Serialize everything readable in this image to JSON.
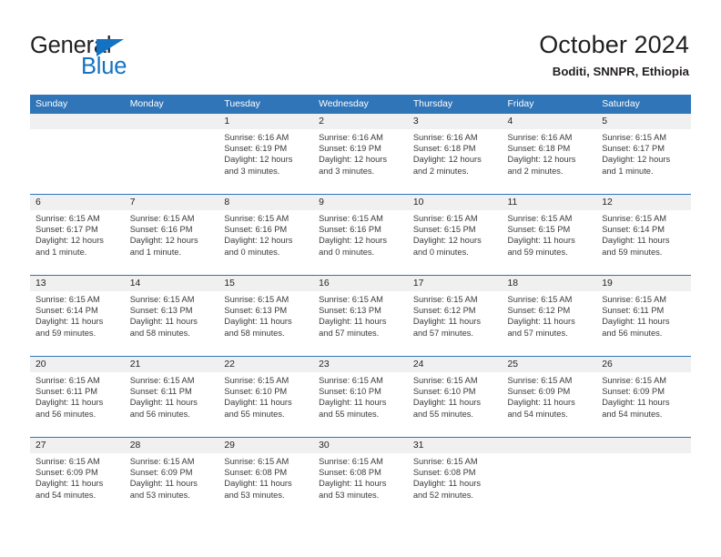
{
  "brand": {
    "name_part1": "General",
    "name_part2": "Blue",
    "triangle_color": "#1272c4"
  },
  "header": {
    "title": "October 2024",
    "subtitle": "Boditi, SNNPR, Ethiopia"
  },
  "theme": {
    "header_blue": "#3075b8",
    "daynum_band": "#f0f0f0",
    "text": "#231f20"
  },
  "weekdays": [
    "Sunday",
    "Monday",
    "Tuesday",
    "Wednesday",
    "Thursday",
    "Friday",
    "Saturday"
  ],
  "weeks": [
    [
      {
        "day": "",
        "sunrise": "",
        "sunset": "",
        "daylight1": "",
        "daylight2": "",
        "empty": true
      },
      {
        "day": "",
        "sunrise": "",
        "sunset": "",
        "daylight1": "",
        "daylight2": "",
        "empty": true
      },
      {
        "day": "1",
        "sunrise": "Sunrise: 6:16 AM",
        "sunset": "Sunset: 6:19 PM",
        "daylight1": "Daylight: 12 hours",
        "daylight2": "and 3 minutes."
      },
      {
        "day": "2",
        "sunrise": "Sunrise: 6:16 AM",
        "sunset": "Sunset: 6:19 PM",
        "daylight1": "Daylight: 12 hours",
        "daylight2": "and 3 minutes."
      },
      {
        "day": "3",
        "sunrise": "Sunrise: 6:16 AM",
        "sunset": "Sunset: 6:18 PM",
        "daylight1": "Daylight: 12 hours",
        "daylight2": "and 2 minutes."
      },
      {
        "day": "4",
        "sunrise": "Sunrise: 6:16 AM",
        "sunset": "Sunset: 6:18 PM",
        "daylight1": "Daylight: 12 hours",
        "daylight2": "and 2 minutes."
      },
      {
        "day": "5",
        "sunrise": "Sunrise: 6:15 AM",
        "sunset": "Sunset: 6:17 PM",
        "daylight1": "Daylight: 12 hours",
        "daylight2": "and 1 minute."
      }
    ],
    [
      {
        "day": "6",
        "sunrise": "Sunrise: 6:15 AM",
        "sunset": "Sunset: 6:17 PM",
        "daylight1": "Daylight: 12 hours",
        "daylight2": "and 1 minute."
      },
      {
        "day": "7",
        "sunrise": "Sunrise: 6:15 AM",
        "sunset": "Sunset: 6:16 PM",
        "daylight1": "Daylight: 12 hours",
        "daylight2": "and 1 minute."
      },
      {
        "day": "8",
        "sunrise": "Sunrise: 6:15 AM",
        "sunset": "Sunset: 6:16 PM",
        "daylight1": "Daylight: 12 hours",
        "daylight2": "and 0 minutes."
      },
      {
        "day": "9",
        "sunrise": "Sunrise: 6:15 AM",
        "sunset": "Sunset: 6:16 PM",
        "daylight1": "Daylight: 12 hours",
        "daylight2": "and 0 minutes."
      },
      {
        "day": "10",
        "sunrise": "Sunrise: 6:15 AM",
        "sunset": "Sunset: 6:15 PM",
        "daylight1": "Daylight: 12 hours",
        "daylight2": "and 0 minutes."
      },
      {
        "day": "11",
        "sunrise": "Sunrise: 6:15 AM",
        "sunset": "Sunset: 6:15 PM",
        "daylight1": "Daylight: 11 hours",
        "daylight2": "and 59 minutes."
      },
      {
        "day": "12",
        "sunrise": "Sunrise: 6:15 AM",
        "sunset": "Sunset: 6:14 PM",
        "daylight1": "Daylight: 11 hours",
        "daylight2": "and 59 minutes."
      }
    ],
    [
      {
        "day": "13",
        "sunrise": "Sunrise: 6:15 AM",
        "sunset": "Sunset: 6:14 PM",
        "daylight1": "Daylight: 11 hours",
        "daylight2": "and 59 minutes."
      },
      {
        "day": "14",
        "sunrise": "Sunrise: 6:15 AM",
        "sunset": "Sunset: 6:13 PM",
        "daylight1": "Daylight: 11 hours",
        "daylight2": "and 58 minutes."
      },
      {
        "day": "15",
        "sunrise": "Sunrise: 6:15 AM",
        "sunset": "Sunset: 6:13 PM",
        "daylight1": "Daylight: 11 hours",
        "daylight2": "and 58 minutes."
      },
      {
        "day": "16",
        "sunrise": "Sunrise: 6:15 AM",
        "sunset": "Sunset: 6:13 PM",
        "daylight1": "Daylight: 11 hours",
        "daylight2": "and 57 minutes."
      },
      {
        "day": "17",
        "sunrise": "Sunrise: 6:15 AM",
        "sunset": "Sunset: 6:12 PM",
        "daylight1": "Daylight: 11 hours",
        "daylight2": "and 57 minutes."
      },
      {
        "day": "18",
        "sunrise": "Sunrise: 6:15 AM",
        "sunset": "Sunset: 6:12 PM",
        "daylight1": "Daylight: 11 hours",
        "daylight2": "and 57 minutes."
      },
      {
        "day": "19",
        "sunrise": "Sunrise: 6:15 AM",
        "sunset": "Sunset: 6:11 PM",
        "daylight1": "Daylight: 11 hours",
        "daylight2": "and 56 minutes."
      }
    ],
    [
      {
        "day": "20",
        "sunrise": "Sunrise: 6:15 AM",
        "sunset": "Sunset: 6:11 PM",
        "daylight1": "Daylight: 11 hours",
        "daylight2": "and 56 minutes."
      },
      {
        "day": "21",
        "sunrise": "Sunrise: 6:15 AM",
        "sunset": "Sunset: 6:11 PM",
        "daylight1": "Daylight: 11 hours",
        "daylight2": "and 56 minutes."
      },
      {
        "day": "22",
        "sunrise": "Sunrise: 6:15 AM",
        "sunset": "Sunset: 6:10 PM",
        "daylight1": "Daylight: 11 hours",
        "daylight2": "and 55 minutes."
      },
      {
        "day": "23",
        "sunrise": "Sunrise: 6:15 AM",
        "sunset": "Sunset: 6:10 PM",
        "daylight1": "Daylight: 11 hours",
        "daylight2": "and 55 minutes."
      },
      {
        "day": "24",
        "sunrise": "Sunrise: 6:15 AM",
        "sunset": "Sunset: 6:10 PM",
        "daylight1": "Daylight: 11 hours",
        "daylight2": "and 55 minutes."
      },
      {
        "day": "25",
        "sunrise": "Sunrise: 6:15 AM",
        "sunset": "Sunset: 6:09 PM",
        "daylight1": "Daylight: 11 hours",
        "daylight2": "and 54 minutes."
      },
      {
        "day": "26",
        "sunrise": "Sunrise: 6:15 AM",
        "sunset": "Sunset: 6:09 PM",
        "daylight1": "Daylight: 11 hours",
        "daylight2": "and 54 minutes."
      }
    ],
    [
      {
        "day": "27",
        "sunrise": "Sunrise: 6:15 AM",
        "sunset": "Sunset: 6:09 PM",
        "daylight1": "Daylight: 11 hours",
        "daylight2": "and 54 minutes."
      },
      {
        "day": "28",
        "sunrise": "Sunrise: 6:15 AM",
        "sunset": "Sunset: 6:09 PM",
        "daylight1": "Daylight: 11 hours",
        "daylight2": "and 53 minutes."
      },
      {
        "day": "29",
        "sunrise": "Sunrise: 6:15 AM",
        "sunset": "Sunset: 6:08 PM",
        "daylight1": "Daylight: 11 hours",
        "daylight2": "and 53 minutes."
      },
      {
        "day": "30",
        "sunrise": "Sunrise: 6:15 AM",
        "sunset": "Sunset: 6:08 PM",
        "daylight1": "Daylight: 11 hours",
        "daylight2": "and 53 minutes."
      },
      {
        "day": "31",
        "sunrise": "Sunrise: 6:15 AM",
        "sunset": "Sunset: 6:08 PM",
        "daylight1": "Daylight: 11 hours",
        "daylight2": "and 52 minutes."
      },
      {
        "day": "",
        "sunrise": "",
        "sunset": "",
        "daylight1": "",
        "daylight2": "",
        "empty": true
      },
      {
        "day": "",
        "sunrise": "",
        "sunset": "",
        "daylight1": "",
        "daylight2": "",
        "empty": true
      }
    ]
  ]
}
